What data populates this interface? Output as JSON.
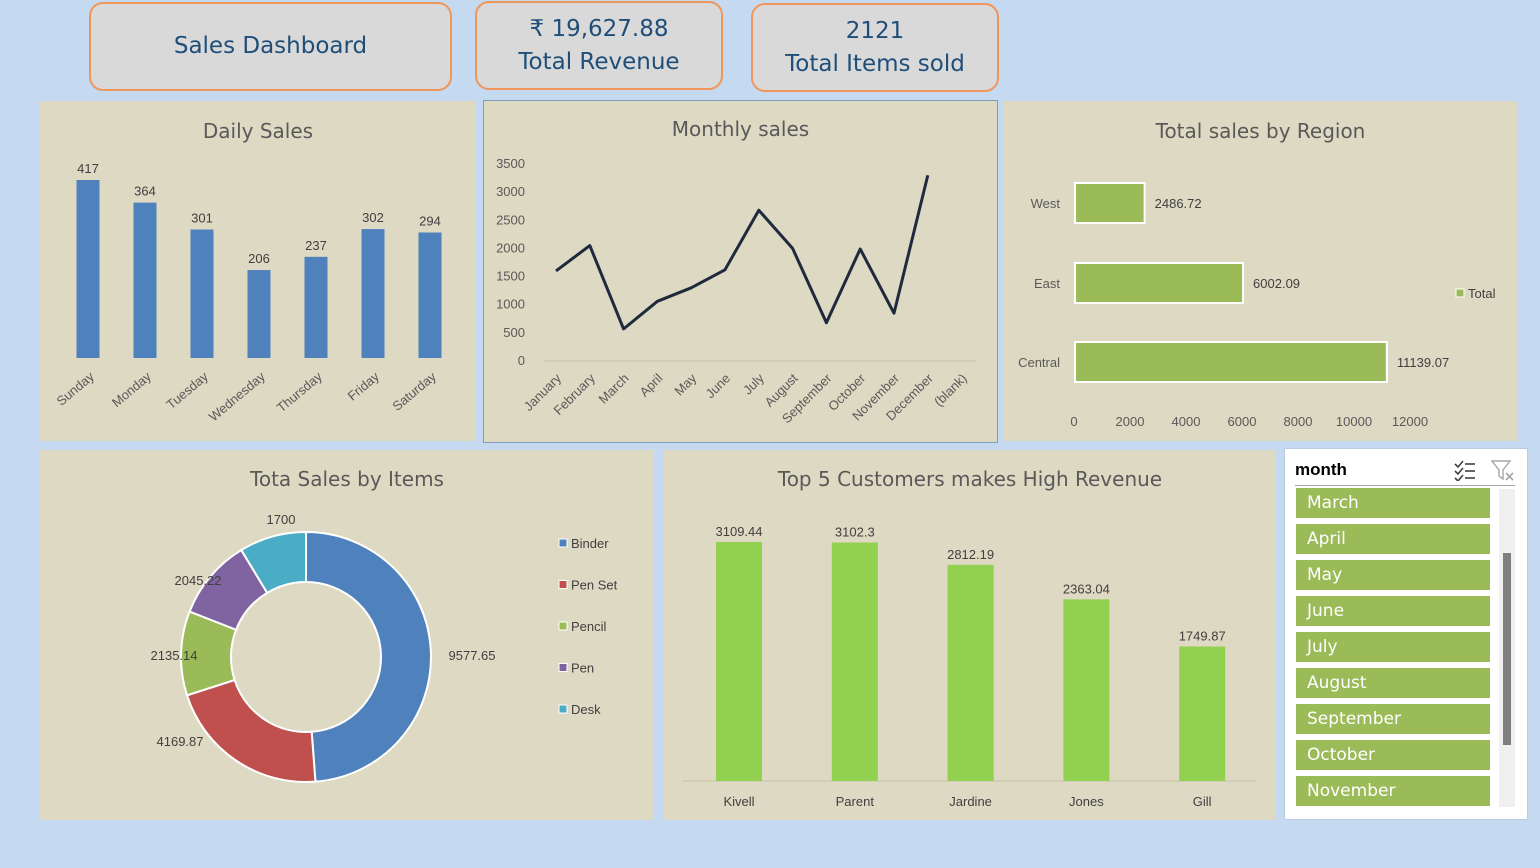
{
  "kpis": {
    "title": "Sales Dashboard",
    "revenue_value": "₹ 19,627.88",
    "revenue_label": "Total Revenue",
    "items_value": "2121",
    "items_label": "Total Items sold"
  },
  "colors": {
    "page_bg": "#c5d9f1",
    "panel_bg": "#ddd9c3",
    "kpi_border": "#f0965a",
    "blue_bar": "#4f81bd",
    "green_bar": "#9bbb59",
    "bright_green": "#92d050",
    "line": "#1f2a3d"
  },
  "chart_data": [
    {
      "id": "daily",
      "type": "bar",
      "title": "Daily Sales",
      "categories": [
        "Sunday",
        "Monday",
        "Tuesday",
        "Wednesday",
        "Thursday",
        "Friday",
        "Saturday"
      ],
      "values": [
        417,
        364,
        301,
        206,
        237,
        302,
        294
      ],
      "data_labels": [
        "417",
        "364",
        "301",
        "206",
        "237",
        "302",
        "294"
      ],
      "grid": false,
      "legend": "none"
    },
    {
      "id": "monthly",
      "type": "line",
      "title": "Monthly sales",
      "categories": [
        "January",
        "February",
        "March",
        "April",
        "May",
        "June",
        "July",
        "August",
        "September",
        "October",
        "November",
        "December",
        "(blank)"
      ],
      "values": [
        1600,
        2050,
        570,
        1060,
        1300,
        1620,
        2680,
        2000,
        680,
        1990,
        850,
        3300,
        null
      ],
      "ylim": [
        0,
        3500
      ],
      "yticks": [
        "0",
        "500",
        "1000",
        "1500",
        "2000",
        "2500",
        "3000",
        "3500"
      ],
      "grid": false,
      "legend": "none"
    },
    {
      "id": "region",
      "type": "bar",
      "orientation": "horizontal",
      "title": "Total sales by Region",
      "categories": [
        "West",
        "East",
        "Central"
      ],
      "values": [
        2486.72,
        6002.09,
        11139.07
      ],
      "data_labels": [
        "2486.72",
        "6002.09",
        "11139.07"
      ],
      "xlim": [
        0,
        12000
      ],
      "xticks": [
        "0",
        "2000",
        "4000",
        "6000",
        "8000",
        "10000",
        "12000"
      ],
      "series": [
        {
          "name": "Total"
        }
      ],
      "legend": "right",
      "grid": false
    },
    {
      "id": "items",
      "type": "pie",
      "subtype": "donut",
      "title": "Tota Sales by Items",
      "labels": [
        "Binder",
        "Pen Set",
        "Pencil",
        "Pen",
        "Desk"
      ],
      "values": [
        9577.65,
        4169.87,
        2135.14,
        2045.22,
        1700
      ],
      "data_labels": [
        "9577.65",
        "4169.87",
        "2135.14",
        "2045.22",
        "1700"
      ],
      "colors": [
        "#4f81bd",
        "#c0504d",
        "#9bbb59",
        "#8064a2",
        "#4bacc6"
      ],
      "legend": "right"
    },
    {
      "id": "customers",
      "type": "bar",
      "title": "Top 5 Customers makes High Revenue",
      "categories": [
        "Kivell",
        "Parent",
        "Jardine",
        "Jones",
        "Gill"
      ],
      "values": [
        3109.44,
        3102.3,
        2812.19,
        2363.04,
        1749.87
      ],
      "data_labels": [
        "3109.44",
        "3102.3",
        "2812.19",
        "2363.04",
        "1749.87"
      ],
      "grid": false,
      "legend": "none"
    }
  ],
  "slicer": {
    "title": "month",
    "multi_select_icon": "multi-select-icon",
    "clear_filter_icon": "clear-filter-icon",
    "items": [
      "March",
      "April",
      "May",
      "June",
      "July",
      "August",
      "September",
      "October",
      "November"
    ]
  }
}
